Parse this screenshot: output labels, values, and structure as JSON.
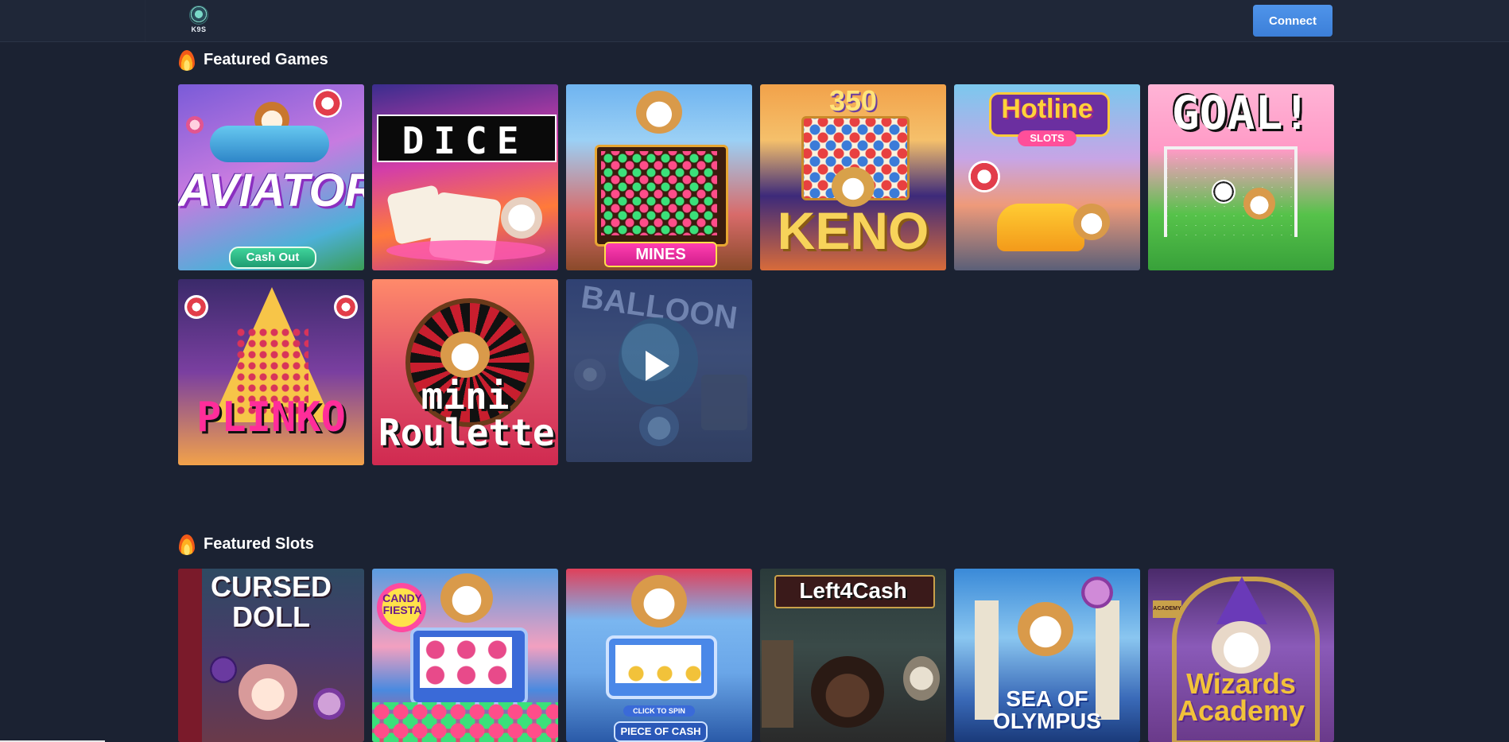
{
  "header": {
    "logo_text": "K9S",
    "connect_label": "Connect"
  },
  "colors": {
    "background": "#1b2232",
    "topbar": "#1f2738",
    "button": "#4a8fe6"
  },
  "sections": {
    "games": {
      "title": "Featured Games",
      "icon": "fire-icon",
      "tiles": [
        {
          "label": "AVIATOR",
          "sub": "Cash Out"
        },
        {
          "label": "DICE",
          "sub": ""
        },
        {
          "label": "MINES",
          "sub": ""
        },
        {
          "label": "KENO",
          "sub": "350"
        },
        {
          "label": "Hotline",
          "sub": "SLOTS"
        },
        {
          "label": "GOAL!",
          "sub": ""
        },
        {
          "label": "PLINKO",
          "sub": ""
        },
        {
          "label": "mini Roulette",
          "sub": ""
        },
        {
          "label": "BALLOON",
          "sub": ""
        }
      ]
    },
    "slots": {
      "title": "Featured Slots",
      "icon": "fire-icon",
      "tiles": [
        {
          "label": "CURSED DOLL",
          "sub": ""
        },
        {
          "label": "CANDY FIESTA",
          "sub": ""
        },
        {
          "label": "PIECE OF CASH",
          "sub": "CLICK TO SPIN"
        },
        {
          "label": "Left4Cash",
          "sub": ""
        },
        {
          "label": "SEA OF OLYMPUS",
          "sub": ""
        },
        {
          "label": "Wizards Academy",
          "sub": ""
        }
      ]
    }
  }
}
